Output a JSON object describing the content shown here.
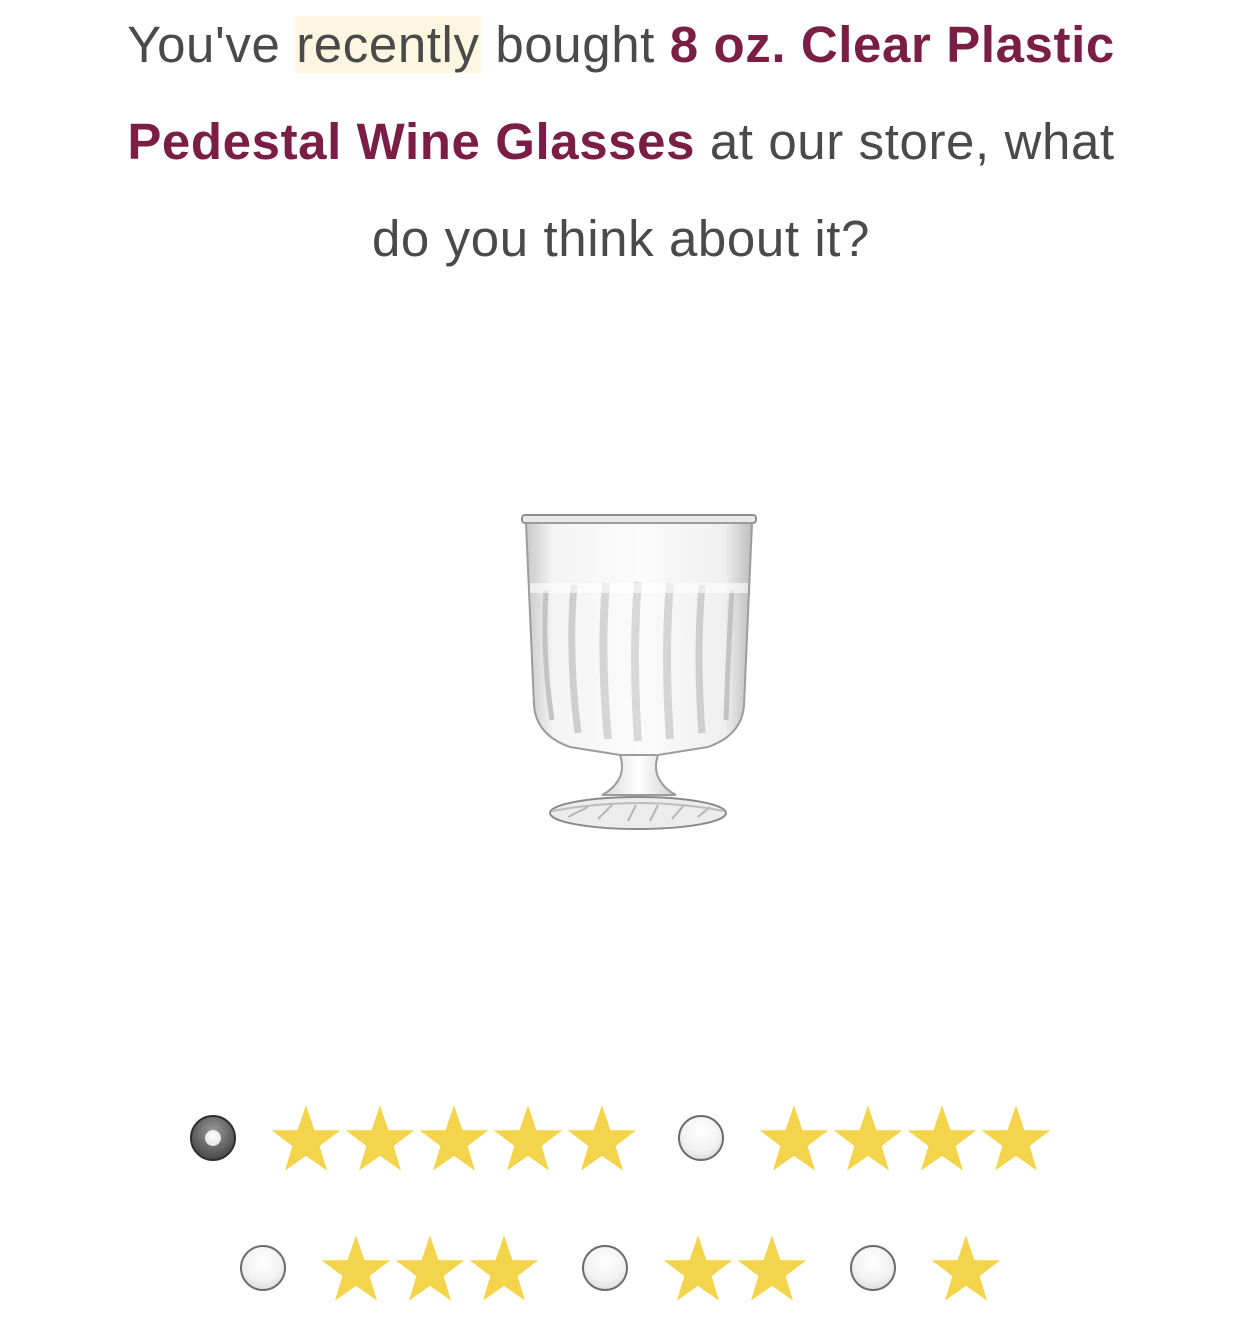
{
  "question": {
    "prefix": "You've",
    "highlighted_word": "recently",
    "middle": "bought",
    "product_name": "8 oz. Clear Plastic Pedestal Wine Glasses",
    "suffix": "at our store, what do you think about it?"
  },
  "product_image": {
    "icon": "wine-glass-icon",
    "alt": "8 oz. Clear Plastic Pedestal Wine Glasses"
  },
  "colors": {
    "product_name": "#7b1e46",
    "body_text": "#4a4a4a",
    "highlight_bg": "#fdf6e0",
    "star": "#f3d44a"
  },
  "rating": {
    "selected": 5,
    "options": [
      {
        "stars": 5,
        "checked": true
      },
      {
        "stars": 4,
        "checked": false
      },
      {
        "stars": 3,
        "checked": false
      },
      {
        "stars": 2,
        "checked": false
      },
      {
        "stars": 1,
        "checked": false
      }
    ]
  }
}
